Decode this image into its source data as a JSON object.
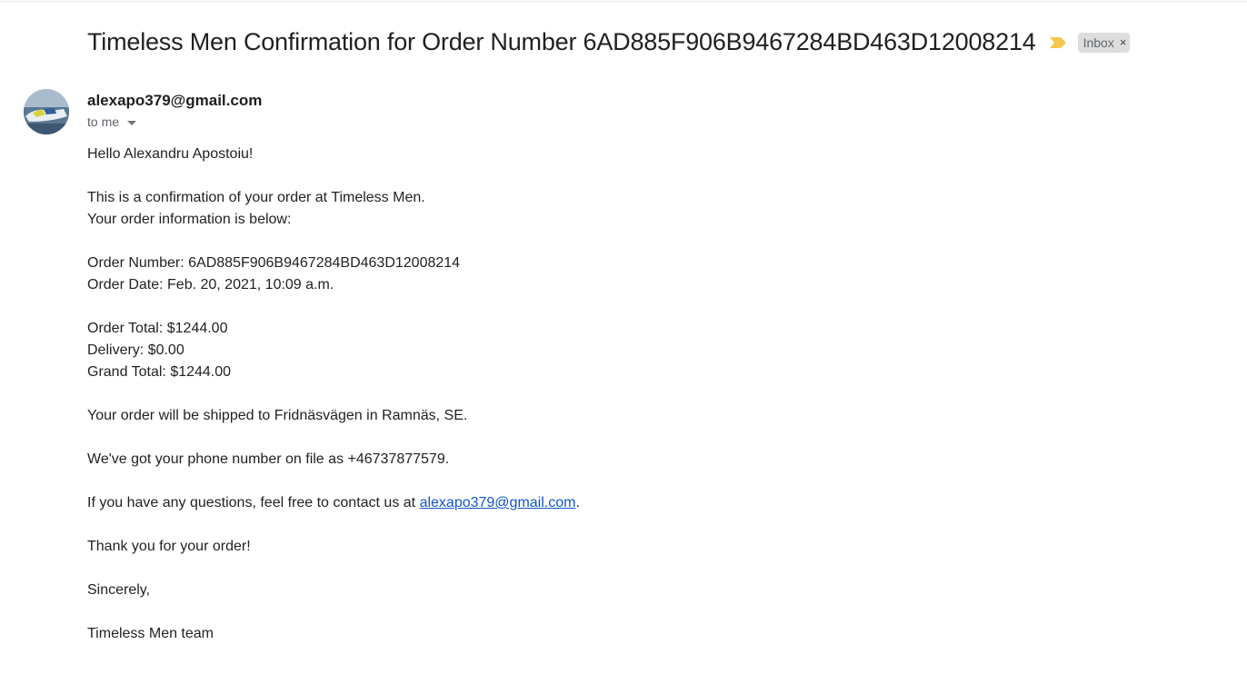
{
  "email": {
    "subject": "Timeless Men Confirmation for Order Number 6AD885F906B9467284BD463D12008214",
    "label": "Inbox",
    "label_close": "×",
    "importance_icon": "importance-marker-icon",
    "importance_color": "#f2c94c",
    "sender": "alexapo379@gmail.com",
    "recipient": "to me",
    "body": {
      "greeting": "Hello Alexandru Apostoiu!",
      "intro_1": "This is a confirmation of your order at Timeless Men.",
      "intro_2": "Your order information is below:",
      "order_number": "Order Number: 6AD885F906B9467284BD463D12008214",
      "order_date": "Order Date: Feb. 20, 2021, 10:09 a.m.",
      "order_total": "Order Total: $1244.00",
      "delivery": "Delivery: $0.00",
      "grand_total": "Grand Total: $1244.00",
      "shipping": "Your order will be shipped to Fridnäsvägen in Ramnäs, SE.",
      "phone": "We've got your phone number on file as +46737877579.",
      "contact_prefix": "If you have any questions, feel free to contact us at ",
      "contact_email": "alexapo379@gmail.com",
      "contact_suffix": ".",
      "thanks": "Thank you for your order!",
      "closing": "Sincerely,",
      "signature": "Timeless Men team"
    }
  },
  "colors": {
    "link": "#1155cc",
    "label_bg": "#dddddd"
  }
}
